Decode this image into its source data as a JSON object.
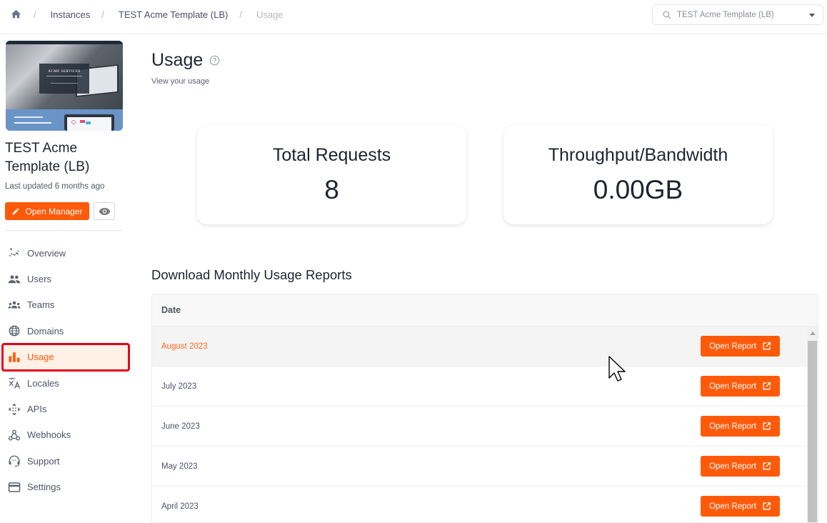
{
  "breadcrumb": {
    "home_icon": "home-icon",
    "items": [
      {
        "label": "Instances"
      },
      {
        "label": "TEST Acme Template (LB)"
      },
      {
        "label": "Usage"
      }
    ],
    "separator": "/"
  },
  "instance_select": {
    "icon": "search-icon",
    "value": "TEST Acme Template (LB)"
  },
  "sidebar": {
    "thumbnail": {
      "headline": "ACME SERVICES"
    },
    "instance_name": "TEST Acme Template (LB)",
    "last_updated": "Last updated 6 months ago",
    "open_manager_label": "Open Manager",
    "nav": [
      {
        "label": "Overview",
        "icon": "sparkle-chart-icon"
      },
      {
        "label": "Users",
        "icon": "users-icon"
      },
      {
        "label": "Teams",
        "icon": "teams-icon"
      },
      {
        "label": "Domains",
        "icon": "globe-icon"
      },
      {
        "label": "Usage",
        "icon": "bar-chart-icon",
        "active": true
      },
      {
        "label": "Locales",
        "icon": "translate-icon"
      },
      {
        "label": "APIs",
        "icon": "api-icon"
      },
      {
        "label": "Webhooks",
        "icon": "webhook-icon"
      },
      {
        "label": "Support",
        "icon": "support-icon"
      },
      {
        "label": "Settings",
        "icon": "credit-card-icon"
      }
    ]
  },
  "main": {
    "title": "Usage",
    "subtitle": "View your usage",
    "stats": [
      {
        "label": "Total Requests",
        "value": "8"
      },
      {
        "label": "Throughput/Bandwidth",
        "value": "0.00GB"
      }
    ],
    "reports": {
      "title": "Download Monthly Usage Reports",
      "column_header": "Date",
      "button_label": "Open Report",
      "rows": [
        {
          "date": "August 2023"
        },
        {
          "date": "July 2023"
        },
        {
          "date": "June 2023"
        },
        {
          "date": "May 2023"
        },
        {
          "date": "April 2023"
        }
      ]
    }
  },
  "colors": {
    "accent": "#ff5a09",
    "active_highlight_border": "#e4001b",
    "active_background": "#fff1e6"
  }
}
